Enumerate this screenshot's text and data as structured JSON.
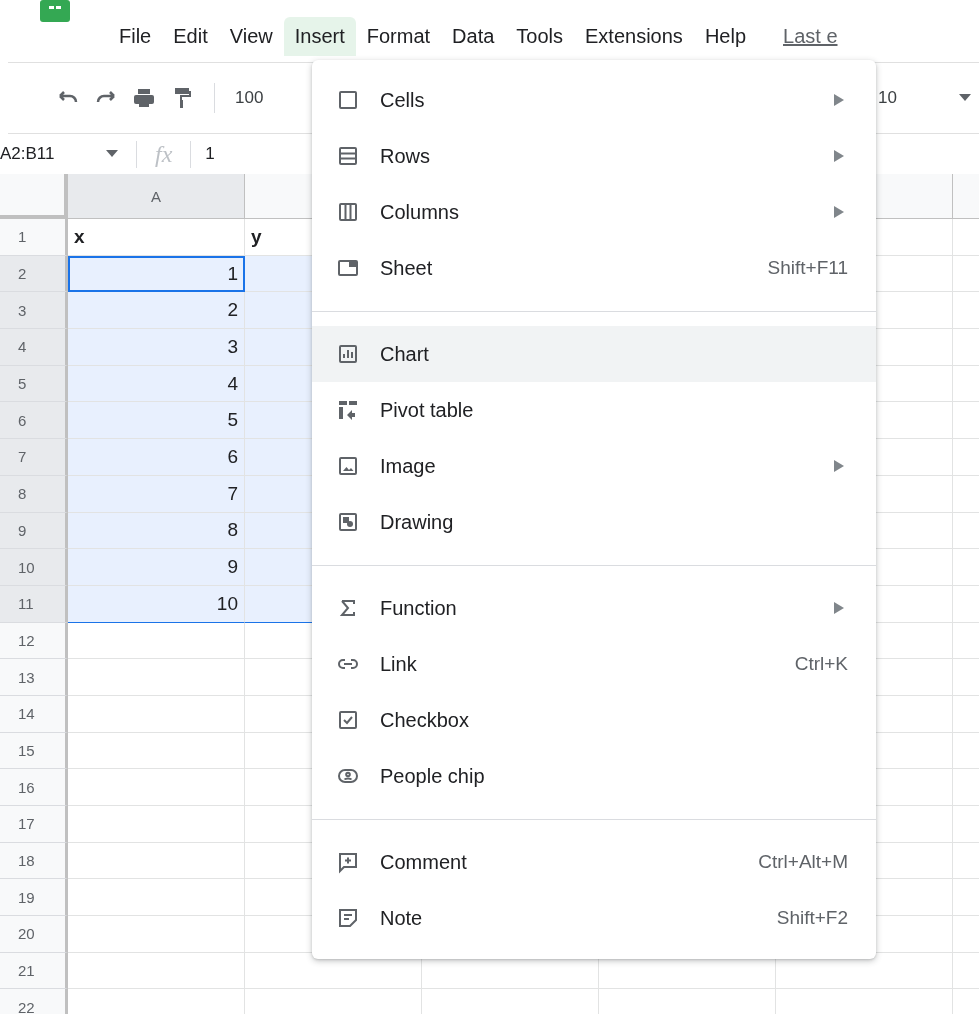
{
  "menu_bar": {
    "items": [
      {
        "label": "File",
        "selected": false
      },
      {
        "label": "Edit",
        "selected": false
      },
      {
        "label": "View",
        "selected": false
      },
      {
        "label": "Insert",
        "selected": true
      },
      {
        "label": "Format",
        "selected": false
      },
      {
        "label": "Data",
        "selected": false
      },
      {
        "label": "Tools",
        "selected": false
      },
      {
        "label": "Extensions",
        "selected": false
      },
      {
        "label": "Help",
        "selected": false
      }
    ],
    "last_edit": "Last e"
  },
  "toolbar": {
    "zoom": "100",
    "font_size": "10"
  },
  "formula_bar": {
    "name_box": "A2:B11",
    "fx": "fx",
    "value": "1"
  },
  "columns": [
    {
      "label": "A",
      "selected": true
    }
  ],
  "rows": [
    {
      "number": "1",
      "kind": "header",
      "selected": false,
      "cells": [
        "x",
        "y"
      ]
    },
    {
      "number": "2",
      "kind": "value",
      "selected": true,
      "active": true,
      "cells": [
        "1"
      ]
    },
    {
      "number": "3",
      "kind": "value",
      "selected": true,
      "cells": [
        "2"
      ]
    },
    {
      "number": "4",
      "kind": "value",
      "selected": true,
      "cells": [
        "3"
      ]
    },
    {
      "number": "5",
      "kind": "value",
      "selected": true,
      "cells": [
        "4"
      ]
    },
    {
      "number": "6",
      "kind": "value",
      "selected": true,
      "cells": [
        "5"
      ]
    },
    {
      "number": "7",
      "kind": "value",
      "selected": true,
      "cells": [
        "6"
      ]
    },
    {
      "number": "8",
      "kind": "value",
      "selected": true,
      "cells": [
        "7"
      ]
    },
    {
      "number": "9",
      "kind": "value",
      "selected": true,
      "cells": [
        "8"
      ]
    },
    {
      "number": "10",
      "kind": "value",
      "selected": true,
      "cells": [
        "9"
      ]
    },
    {
      "number": "11",
      "kind": "value",
      "selected": true,
      "cells": [
        "10"
      ]
    },
    {
      "number": "12",
      "kind": "value",
      "selected": false,
      "cells": []
    },
    {
      "number": "13",
      "kind": "value",
      "selected": false,
      "cells": []
    },
    {
      "number": "14",
      "kind": "value",
      "selected": false,
      "cells": []
    },
    {
      "number": "15",
      "kind": "value",
      "selected": false,
      "cells": []
    },
    {
      "number": "16",
      "kind": "value",
      "selected": false,
      "cells": []
    },
    {
      "number": "17",
      "kind": "value",
      "selected": false,
      "cells": []
    },
    {
      "number": "18",
      "kind": "value",
      "selected": false,
      "cells": []
    },
    {
      "number": "19",
      "kind": "value",
      "selected": false,
      "cells": []
    },
    {
      "number": "20",
      "kind": "value",
      "selected": false,
      "cells": []
    },
    {
      "number": "21",
      "kind": "value",
      "selected": false,
      "cells": []
    },
    {
      "number": "22",
      "kind": "value",
      "selected": false,
      "cells": []
    }
  ],
  "insert_menu": [
    {
      "kind": "item",
      "label": "Cells",
      "submenu": true,
      "highlighted": false
    },
    {
      "kind": "item",
      "label": "Rows",
      "submenu": true,
      "highlighted": false
    },
    {
      "kind": "item",
      "label": "Columns",
      "submenu": true,
      "highlighted": false
    },
    {
      "kind": "item",
      "label": "Sheet",
      "shortcut": "Shift+F11",
      "submenu": false,
      "highlighted": false
    },
    {
      "kind": "separator"
    },
    {
      "kind": "item",
      "label": "Chart",
      "submenu": false,
      "highlighted": true
    },
    {
      "kind": "item",
      "label": "Pivot table",
      "submenu": false,
      "highlighted": false
    },
    {
      "kind": "item",
      "label": "Image",
      "submenu": true,
      "highlighted": false
    },
    {
      "kind": "item",
      "label": "Drawing",
      "submenu": false,
      "highlighted": false
    },
    {
      "kind": "separator"
    },
    {
      "kind": "item",
      "label": "Function",
      "submenu": true,
      "highlighted": false
    },
    {
      "kind": "item",
      "label": "Link",
      "shortcut": "Ctrl+K",
      "submenu": false,
      "highlighted": false
    },
    {
      "kind": "item",
      "label": "Checkbox",
      "submenu": false,
      "highlighted": false
    },
    {
      "kind": "item",
      "label": "People chip",
      "submenu": false,
      "highlighted": false
    },
    {
      "kind": "separator"
    },
    {
      "kind": "item",
      "label": "Comment",
      "shortcut": "Ctrl+Alt+M",
      "submenu": false,
      "highlighted": false
    },
    {
      "kind": "item",
      "label": "Note",
      "shortcut": "Shift+F2",
      "submenu": false,
      "highlighted": false
    }
  ]
}
